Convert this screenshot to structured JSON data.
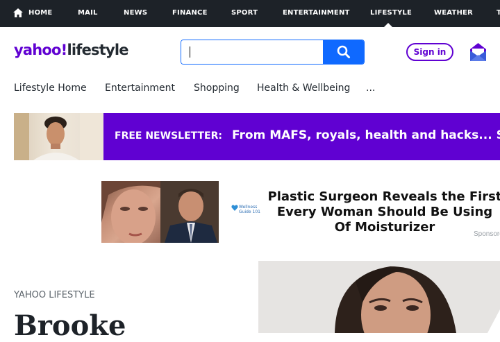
{
  "top_nav": {
    "items": [
      "HOME",
      "MAIL",
      "NEWS",
      "FINANCE",
      "SPORT",
      "ENTERTAINMENT",
      "LIFESTYLE",
      "WEATHER",
      "T"
    ],
    "active": "LIFESTYLE"
  },
  "header": {
    "logo_yahoo": "yahoo!",
    "logo_section": "lifestyle",
    "search_value": "",
    "sign_in_label": "Sign in"
  },
  "sub_nav": {
    "items": [
      "Lifestyle Home",
      "Entertainment",
      "Shopping",
      "Health & Wellbeing",
      "..."
    ]
  },
  "newsletter_banner": {
    "label": "FREE NEWSLETTER:",
    "headline": "From MAFS, royals, health and hacks... Sign up"
  },
  "ad": {
    "brand_line1": "Wellness",
    "brand_line2": "Guide 101",
    "headline": "Plastic Surgeon Reveals the First\nEvery Woman Should Be Using\nOf Moisturizer",
    "sponsored_label": "Sponsored"
  },
  "article": {
    "kicker": "YAHOO LIFESTYLE",
    "title": "Brooke"
  },
  "colors": {
    "top_nav_bg": "#1d2228",
    "brand_purple": "#6001d2",
    "search_blue": "#0f69ff",
    "text_dark": "#232a31",
    "text_muted": "#5b636a"
  }
}
